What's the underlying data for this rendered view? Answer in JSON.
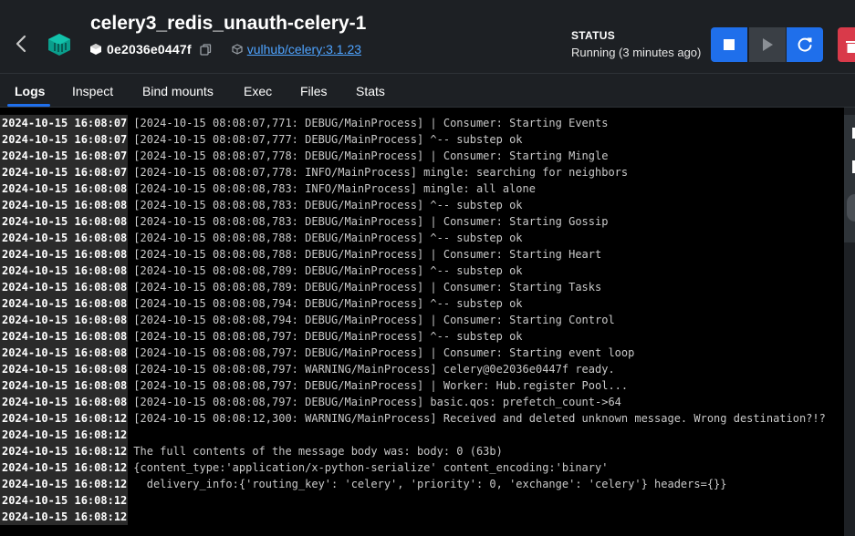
{
  "header": {
    "title": "celery3_redis_unauth-celery-1",
    "container_id": "0e2036e0447f",
    "image_link": "vulhub/celery:3.1.23",
    "status_title": "STATUS",
    "status_text": "Running (3 minutes ago)",
    "accent_color": "#1f6feb",
    "danger_color": "#d93a4a"
  },
  "tabs": [
    {
      "label": "Logs",
      "active": true
    },
    {
      "label": "Inspect"
    },
    {
      "label": "Bind mounts"
    },
    {
      "label": "Exec"
    },
    {
      "label": "Files"
    },
    {
      "label": "Stats"
    }
  ],
  "logs": [
    {
      "ts": "2024-10-15 16:08:07",
      "msg": "[2024-10-15 08:08:07,771: DEBUG/MainProcess] | Consumer: Starting Events"
    },
    {
      "ts": "2024-10-15 16:08:07",
      "msg": "[2024-10-15 08:08:07,777: DEBUG/MainProcess] ^-- substep ok"
    },
    {
      "ts": "2024-10-15 16:08:07",
      "msg": "[2024-10-15 08:08:07,778: DEBUG/MainProcess] | Consumer: Starting Mingle"
    },
    {
      "ts": "2024-10-15 16:08:07",
      "msg": "[2024-10-15 08:08:07,778: INFO/MainProcess] mingle: searching for neighbors"
    },
    {
      "ts": "2024-10-15 16:08:08",
      "msg": "[2024-10-15 08:08:08,783: INFO/MainProcess] mingle: all alone"
    },
    {
      "ts": "2024-10-15 16:08:08",
      "msg": "[2024-10-15 08:08:08,783: DEBUG/MainProcess] ^-- substep ok"
    },
    {
      "ts": "2024-10-15 16:08:08",
      "msg": "[2024-10-15 08:08:08,783: DEBUG/MainProcess] | Consumer: Starting Gossip"
    },
    {
      "ts": "2024-10-15 16:08:08",
      "msg": "[2024-10-15 08:08:08,788: DEBUG/MainProcess] ^-- substep ok"
    },
    {
      "ts": "2024-10-15 16:08:08",
      "msg": "[2024-10-15 08:08:08,788: DEBUG/MainProcess] | Consumer: Starting Heart"
    },
    {
      "ts": "2024-10-15 16:08:08",
      "msg": "[2024-10-15 08:08:08,789: DEBUG/MainProcess] ^-- substep ok"
    },
    {
      "ts": "2024-10-15 16:08:08",
      "msg": "[2024-10-15 08:08:08,789: DEBUG/MainProcess] | Consumer: Starting Tasks"
    },
    {
      "ts": "2024-10-15 16:08:08",
      "msg": "[2024-10-15 08:08:08,794: DEBUG/MainProcess] ^-- substep ok"
    },
    {
      "ts": "2024-10-15 16:08:08",
      "msg": "[2024-10-15 08:08:08,794: DEBUG/MainProcess] | Consumer: Starting Control"
    },
    {
      "ts": "2024-10-15 16:08:08",
      "msg": "[2024-10-15 08:08:08,797: DEBUG/MainProcess] ^-- substep ok"
    },
    {
      "ts": "2024-10-15 16:08:08",
      "msg": "[2024-10-15 08:08:08,797: DEBUG/MainProcess] | Consumer: Starting event loop"
    },
    {
      "ts": "2024-10-15 16:08:08",
      "msg": "[2024-10-15 08:08:08,797: WARNING/MainProcess] celery@0e2036e0447f ready."
    },
    {
      "ts": "2024-10-15 16:08:08",
      "msg": "[2024-10-15 08:08:08,797: DEBUG/MainProcess] | Worker: Hub.register Pool..."
    },
    {
      "ts": "2024-10-15 16:08:08",
      "msg": "[2024-10-15 08:08:08,797: DEBUG/MainProcess] basic.qos: prefetch_count->64"
    },
    {
      "ts": "2024-10-15 16:08:12",
      "msg": "[2024-10-15 08:08:12,300: WARNING/MainProcess] Received and deleted unknown message. Wrong destination?!?"
    },
    {
      "ts": "2024-10-15 16:08:12",
      "msg": ""
    },
    {
      "ts": "2024-10-15 16:08:12",
      "msg": "The full contents of the message body was: body: 0 (63b)"
    },
    {
      "ts": "2024-10-15 16:08:12",
      "msg": "{content_type:'application/x-python-serialize' content_encoding:'binary'"
    },
    {
      "ts": "2024-10-15 16:08:12",
      "msg": "  delivery_info:{'routing_key': 'celery', 'priority': 0, 'exchange': 'celery'} headers={}}"
    },
    {
      "ts": "2024-10-15 16:08:12",
      "msg": ""
    },
    {
      "ts": "2024-10-15 16:08:12",
      "msg": ""
    }
  ]
}
